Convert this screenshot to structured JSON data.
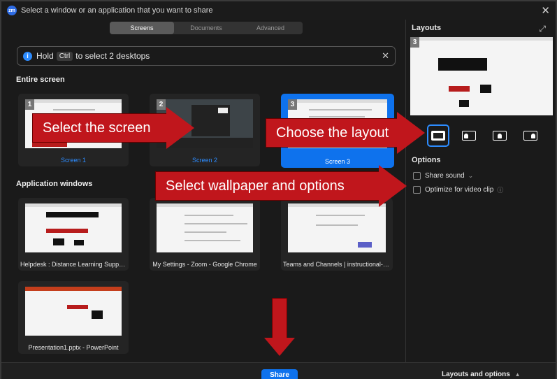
{
  "window": {
    "title": "Select a window or an application that you want to share",
    "app_icon": "zm"
  },
  "tabs": [
    {
      "label": "Screens",
      "active": true
    },
    {
      "label": "Documents",
      "active": false
    },
    {
      "label": "Advanced",
      "active": false
    }
  ],
  "info": {
    "prefix": "Hold",
    "key": "Ctrl",
    "suffix": "to select 2 desktops"
  },
  "sections": {
    "entire_screen": "Entire screen",
    "application_windows": "Application windows"
  },
  "screens": [
    {
      "number": "1",
      "label": "Screen 1",
      "selected": false
    },
    {
      "number": "2",
      "label": "Screen 2",
      "selected": false
    },
    {
      "number": "3",
      "label": "Screen 3",
      "selected": true
    }
  ],
  "apps": [
    {
      "label": "Helpdesk : Distance Learning Support - ..."
    },
    {
      "label": "My Settings - Zoom - Google Chrome"
    },
    {
      "label": "Teams and Channels | instructional-sup..."
    },
    {
      "label": "Presentation1.pptx - PowerPoint"
    }
  ],
  "layouts_panel": {
    "title": "Layouts",
    "preview_number": "3",
    "options_title": "Options",
    "options": [
      {
        "label": "Share sound",
        "checked": false,
        "aux": "⌄"
      },
      {
        "label": "Optimize for video clip",
        "checked": false,
        "aux": "ⓘ"
      }
    ]
  },
  "bottom": {
    "share_label": "Share",
    "layouts_options_label": "Layouts and options",
    "caret": "▲"
  },
  "callouts": {
    "select_screen": "Select the screen",
    "choose_layout": "Choose the layout",
    "select_wallpaper": "Select wallpaper and options"
  },
  "colors": {
    "accent": "#0e72ed",
    "callout": "#c0161c",
    "background": "#1a1a1a"
  }
}
